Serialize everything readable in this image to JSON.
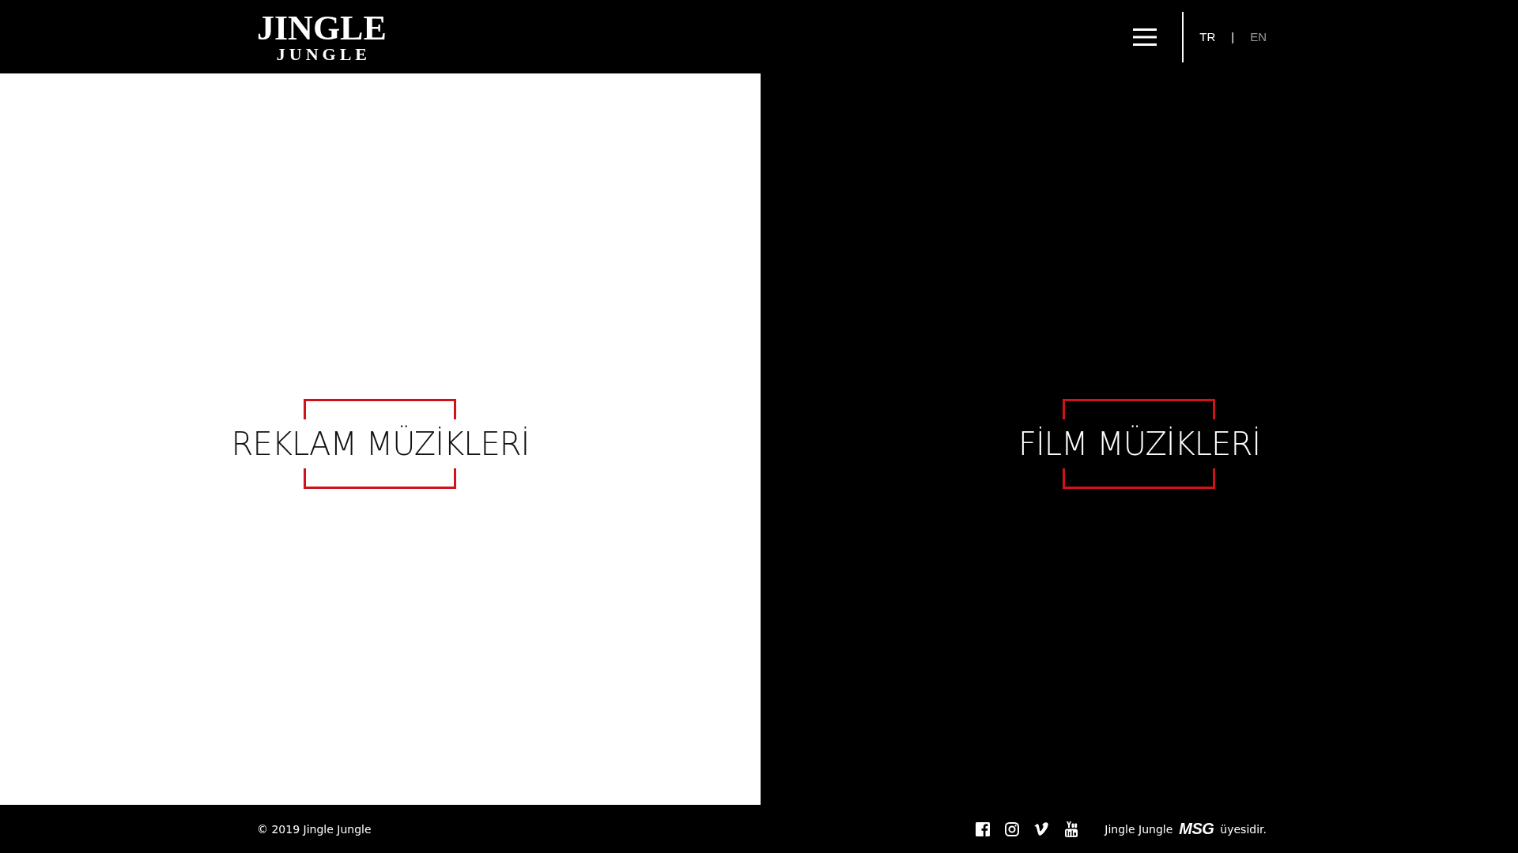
{
  "header": {
    "logo": {
      "line_1": "JINGLE",
      "line_2": "JUNGLE"
    },
    "languages": [
      {
        "label": "TR",
        "selected": true
      },
      {
        "label": "EN",
        "selected": false
      }
    ],
    "language_separator": "|"
  },
  "categories": [
    {
      "label": "REKLAM MÜZİKLERİ",
      "kind": "light"
    },
    {
      "label": "FİLM MÜZİKLERİ",
      "kind": "dark"
    }
  ],
  "footer": {
    "copyright": "© 2019 Jingle Jungle",
    "social": [
      {
        "kind": "facebook"
      },
      {
        "kind": "instagram"
      },
      {
        "kind": "vimeo"
      },
      {
        "kind": "youtube"
      }
    ],
    "membership": {
      "prefix": "Jingle Jungle",
      "logo": "MSG",
      "suffix": "üyesidir."
    }
  }
}
